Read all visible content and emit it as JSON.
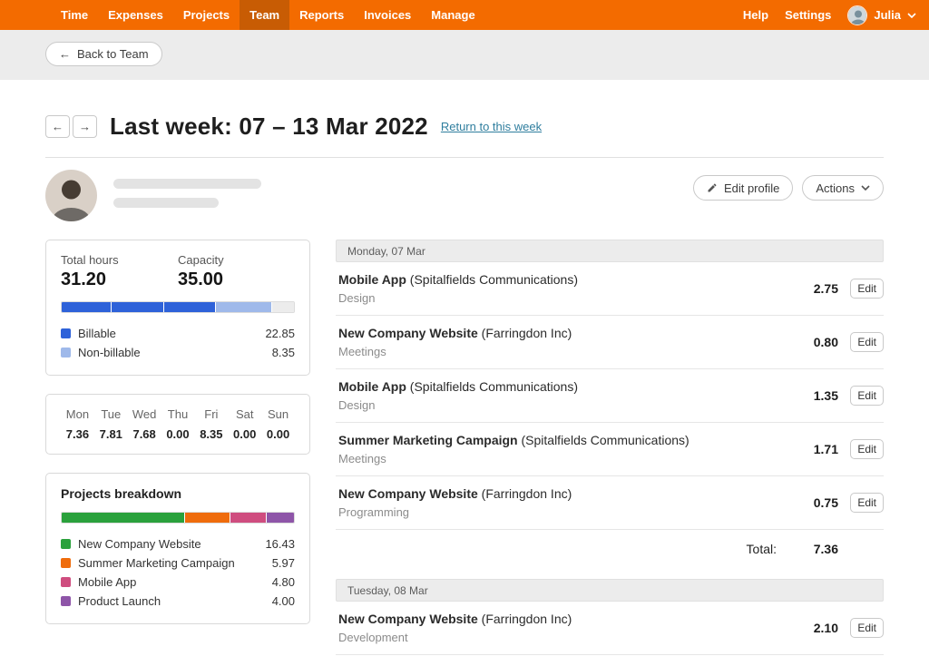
{
  "nav": {
    "items": [
      "Time",
      "Expenses",
      "Projects",
      "Team",
      "Reports",
      "Invoices",
      "Manage"
    ],
    "active": "Team",
    "help": "Help",
    "settings": "Settings",
    "user": "Julia"
  },
  "back_bar": {
    "label": "Back to Team"
  },
  "header": {
    "title": "Last week: 07 – 13 Mar 2022",
    "link": "Return to this week"
  },
  "profile": {
    "edit_button": "Edit profile",
    "actions_button": "Actions"
  },
  "summary": {
    "total_hours_label": "Total hours",
    "total_hours": "31.20",
    "capacity_label": "Capacity",
    "capacity": "35.00",
    "capacity_value": 35,
    "remainder_color": "#ececec",
    "bar_segments": [
      {
        "value": 7.36,
        "color": "#2e62d9"
      },
      {
        "value": 7.81,
        "color": "#2e62d9"
      },
      {
        "value": 7.68,
        "color": "#2e62d9"
      },
      {
        "value": 8.35,
        "color": "#9fb9ea"
      }
    ],
    "legend": [
      {
        "label": "Billable",
        "value": "22.85",
        "color": "#2e62d9"
      },
      {
        "label": "Non-billable",
        "value": "8.35",
        "color": "#9fb9ea"
      }
    ]
  },
  "week": [
    {
      "day": "Mon",
      "value": "7.36"
    },
    {
      "day": "Tue",
      "value": "7.81"
    },
    {
      "day": "Wed",
      "value": "7.68"
    },
    {
      "day": "Thu",
      "value": "0.00"
    },
    {
      "day": "Fri",
      "value": "8.35"
    },
    {
      "day": "Sat",
      "value": "0.00"
    },
    {
      "day": "Sun",
      "value": "0.00"
    }
  ],
  "projects": {
    "title": "Projects breakdown",
    "items": [
      {
        "label": "New Company Website",
        "value": "16.43",
        "num": 16.43,
        "color": "#2aa13c"
      },
      {
        "label": "Summer Marketing Campaign",
        "value": "5.97",
        "num": 5.97,
        "color": "#ef6c0c"
      },
      {
        "label": "Mobile App",
        "value": "4.80",
        "num": 4.8,
        "color": "#cf4d7f"
      },
      {
        "label": "Product Launch",
        "value": "4.00",
        "num": 4.0,
        "color": "#8e55a8"
      }
    ]
  },
  "timesheet": {
    "edit_label": "Edit",
    "days": [
      {
        "date": "Monday, 07 Mar",
        "entries": [
          {
            "project": "Mobile App",
            "client": "(Spitalfields Communications)",
            "task": "Design",
            "hours": "2.75"
          },
          {
            "project": "New Company Website",
            "client": "(Farringdon Inc)",
            "task": "Meetings",
            "hours": "0.80"
          },
          {
            "project": "Mobile App",
            "client": "(Spitalfields Communications)",
            "task": "Design",
            "hours": "1.35"
          },
          {
            "project": "Summer Marketing Campaign",
            "client": "(Spitalfields Communications)",
            "task": "Meetings",
            "hours": "1.71"
          },
          {
            "project": "New Company Website",
            "client": "(Farringdon Inc)",
            "task": "Programming",
            "hours": "0.75"
          }
        ],
        "total_label": "Total:",
        "total": "7.36"
      },
      {
        "date": "Tuesday, 08 Mar",
        "entries": [
          {
            "project": "New Company Website",
            "client": "(Farringdon Inc)",
            "task": "Development",
            "hours": "2.10"
          }
        ]
      }
    ]
  }
}
